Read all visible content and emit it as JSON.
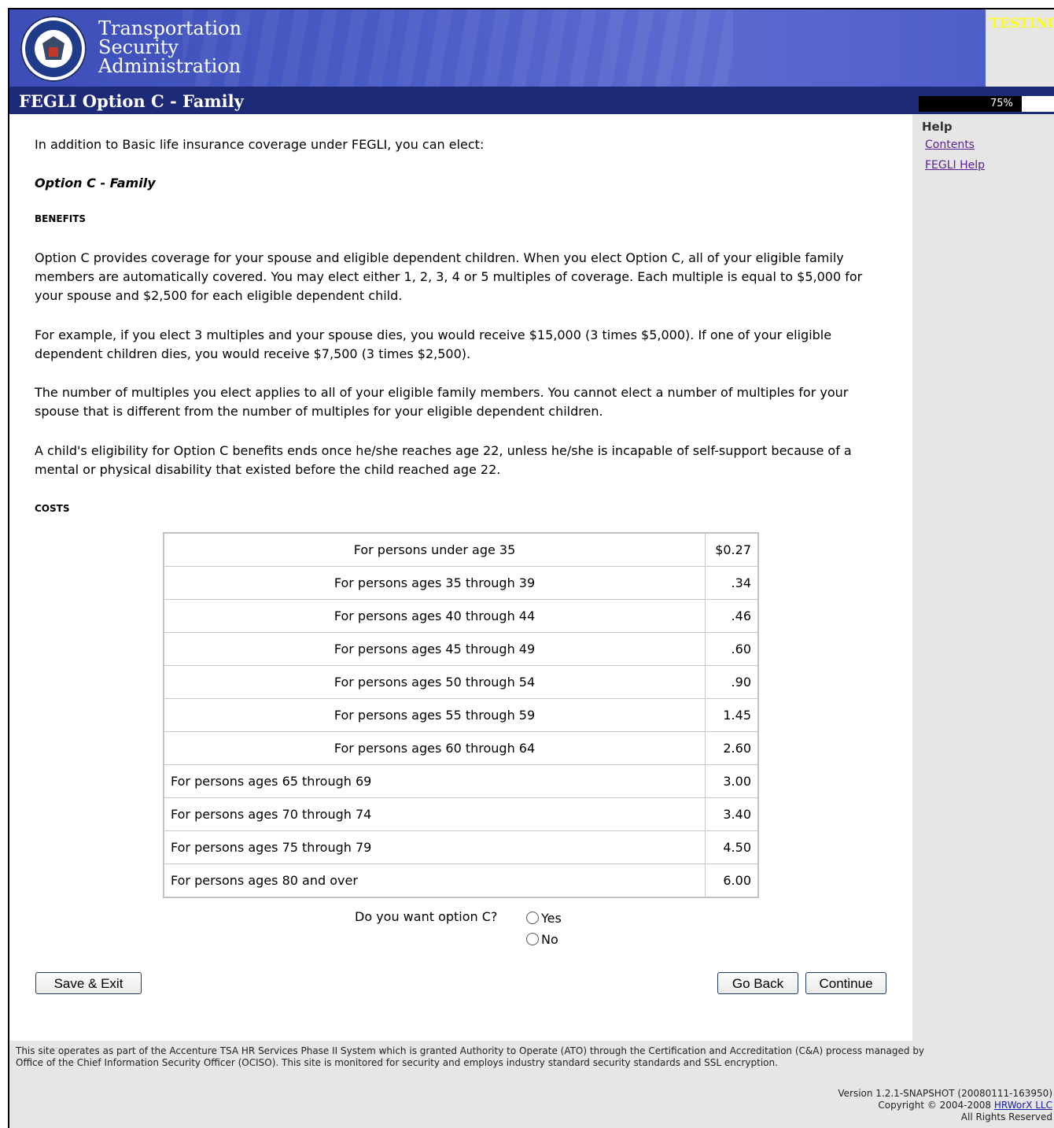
{
  "header": {
    "agency_line1": "Transportation",
    "agency_line2": "Security",
    "agency_line3": "Administration",
    "testing_label": "TESTING",
    "page_title": "FEGLI Option C - Family",
    "progress_percent": 75,
    "progress_label": "75%"
  },
  "help": {
    "heading": "Help",
    "links": [
      "Contents",
      "FEGLI Help"
    ]
  },
  "content": {
    "intro": "In addition to Basic life insurance coverage under FEGLI, you can elect:",
    "option_title": "Option C - Family",
    "benefits_heading": "BENEFITS",
    "para1": "Option C provides coverage for your spouse and eligible dependent children. When you elect Option C, all of your eligible family members are automatically covered. You may elect either 1, 2, 3, 4 or 5 multiples of coverage. Each multiple is equal to $5,000 for your spouse and $2,500 for each eligible dependent child.",
    "para2": "For example, if you elect 3 multiples and your spouse dies, you would receive $15,000 (3 times $5,000). If one of your eligible dependent children dies, you would receive $7,500 (3 times $2,500).",
    "para3": "The number of multiples you elect applies to all of your eligible family members. You cannot elect a number of multiples for your spouse that is different from the number of multiples for your eligible dependent children.",
    "para4": "A child's eligibility for Option C benefits ends once he/she reaches age 22, unless he/she is incapable of self-support because of a mental or physical disability that existed before the child reached age 22.",
    "costs_heading": "COSTS",
    "costs": [
      {
        "label": "For persons under age 35",
        "value": "$0.27"
      },
      {
        "label": "For persons ages 35 through 39",
        "value": ".34"
      },
      {
        "label": "For persons ages 40 through 44",
        "value": ".46"
      },
      {
        "label": "For persons ages 45 through 49",
        "value": ".60"
      },
      {
        "label": "For persons ages 50 through 54",
        "value": ".90"
      },
      {
        "label": "For persons ages 55 through 59",
        "value": "1.45"
      },
      {
        "label": "For persons ages 60 through 64",
        "value": "2.60"
      },
      {
        "label": "For persons ages 65 through 69",
        "value": "3.00"
      },
      {
        "label": "For persons ages 70 through 74",
        "value": "3.40"
      },
      {
        "label": "For persons ages 75 through 79",
        "value": "4.50"
      },
      {
        "label": "For persons ages 80 and over",
        "value": "6.00"
      }
    ],
    "question": "Do you want option C?",
    "option_yes": "Yes",
    "option_no": "No"
  },
  "buttons": {
    "save_exit": "Save & Exit",
    "go_back": "Go Back",
    "continue": "Continue"
  },
  "footer": {
    "line1": "This site operates as part of the Accenture TSA HR Services Phase II System which is granted Authority to Operate (ATO) through the Certification and Accreditation (C&A) process managed by",
    "line2": "Office of the Chief Information Security Officer (OCISO). This site is monitored for security and employs industry standard security standards and SSL encryption.",
    "version": "Version 1.2.1-SNAPSHOT (20080111-163950)",
    "copyright": "Copyright © 2004-2008 ",
    "company": "HRWorX LLC",
    "rights": "All Rights Reserved"
  }
}
